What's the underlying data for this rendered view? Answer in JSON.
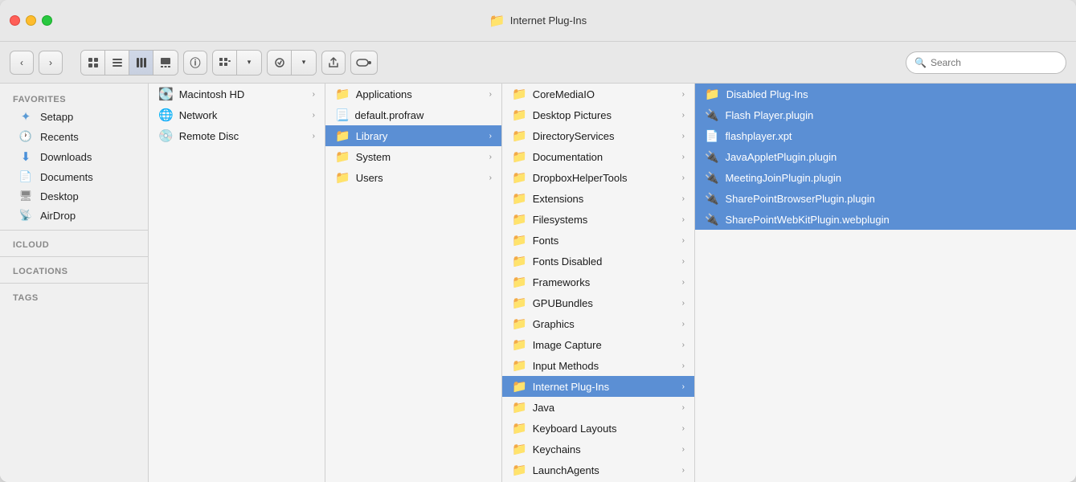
{
  "window": {
    "title": "Internet Plug-Ins"
  },
  "titlebar": {
    "title": "Internet Plug-Ins"
  },
  "toolbar": {
    "view_icon_grid": "⊞",
    "view_icon_list": "≡",
    "view_icon_column": "|||",
    "view_icon_cover": "▭",
    "info_label": "ⓘ",
    "group_label": "⊡",
    "action_label": "⚙",
    "share_label": "↑",
    "tag_label": "◯",
    "search_placeholder": "Search"
  },
  "sidebar": {
    "favorites_label": "Favorites",
    "icloud_label": "iCloud",
    "locations_label": "Locations",
    "tags_label": "Tags",
    "items": [
      {
        "id": "setapp",
        "label": "Setapp",
        "icon": "✦"
      },
      {
        "id": "recents",
        "label": "Recents",
        "icon": "🕐"
      },
      {
        "id": "downloads",
        "label": "Downloads",
        "icon": "⬇"
      },
      {
        "id": "documents",
        "label": "Documents",
        "icon": "📄"
      },
      {
        "id": "desktop",
        "label": "Desktop",
        "icon": "🖥"
      },
      {
        "id": "airdrop",
        "label": "AirDrop",
        "icon": "📡"
      }
    ]
  },
  "col1": {
    "items": [
      {
        "id": "macintosh-hd",
        "label": "Macintosh HD",
        "hasArrow": true,
        "iconType": "disk"
      },
      {
        "id": "network",
        "label": "Network",
        "hasArrow": true,
        "iconType": "network"
      },
      {
        "id": "remote-disc",
        "label": "Remote Disc",
        "hasArrow": true,
        "iconType": "disk"
      }
    ]
  },
  "col2": {
    "items": [
      {
        "id": "applications",
        "label": "Applications",
        "hasArrow": true,
        "selected": false
      },
      {
        "id": "default-profraw",
        "label": "default.profraw",
        "hasArrow": false,
        "selected": false
      },
      {
        "id": "library",
        "label": "Library",
        "hasArrow": true,
        "selected": true
      },
      {
        "id": "system",
        "label": "System",
        "hasArrow": true,
        "selected": false
      },
      {
        "id": "users",
        "label": "Users",
        "hasArrow": true,
        "selected": false
      }
    ]
  },
  "col3": {
    "items": [
      {
        "id": "coremediaio",
        "label": "CoreMediaIO",
        "hasArrow": true
      },
      {
        "id": "desktop-pictures",
        "label": "Desktop Pictures",
        "hasArrow": true
      },
      {
        "id": "directoryservices",
        "label": "DirectoryServices",
        "hasArrow": true
      },
      {
        "id": "documentation",
        "label": "Documentation",
        "hasArrow": true
      },
      {
        "id": "dropboxhelpertools",
        "label": "DropboxHelperTools",
        "hasArrow": true
      },
      {
        "id": "extensions",
        "label": "Extensions",
        "hasArrow": true
      },
      {
        "id": "filesystems",
        "label": "Filesystems",
        "hasArrow": true
      },
      {
        "id": "fonts",
        "label": "Fonts",
        "hasArrow": true
      },
      {
        "id": "fonts-disabled",
        "label": "Fonts Disabled",
        "hasArrow": true
      },
      {
        "id": "frameworks",
        "label": "Frameworks",
        "hasArrow": true
      },
      {
        "id": "gpubundles",
        "label": "GPUBundles",
        "hasArrow": true
      },
      {
        "id": "graphics",
        "label": "Graphics",
        "hasArrow": true
      },
      {
        "id": "image-capture",
        "label": "Image Capture",
        "hasArrow": true
      },
      {
        "id": "input-methods",
        "label": "Input Methods",
        "hasArrow": true
      },
      {
        "id": "internet-plug-ins",
        "label": "Internet Plug-Ins",
        "hasArrow": true,
        "selected": true
      },
      {
        "id": "java",
        "label": "Java",
        "hasArrow": true
      },
      {
        "id": "keyboard-layouts",
        "label": "Keyboard Layouts",
        "hasArrow": true
      },
      {
        "id": "keychains",
        "label": "Keychains",
        "hasArrow": true
      },
      {
        "id": "launchagents",
        "label": "LaunchAgents",
        "hasArrow": true
      }
    ]
  },
  "col4": {
    "items": [
      {
        "id": "disabled-plug-ins",
        "label": "Disabled Plug-Ins",
        "iconType": "folder-selected"
      },
      {
        "id": "flash-player-plugin",
        "label": "Flash Player.plugin",
        "iconType": "plugin-selected"
      },
      {
        "id": "flashplayer-xpt",
        "label": "flashplayer.xpt",
        "iconType": "xpt-selected"
      },
      {
        "id": "javaappletplugin",
        "label": "JavaAppletPlugin.plugin",
        "iconType": "plugin-selected"
      },
      {
        "id": "meetingjoinplugin",
        "label": "MeetingJoinPlugin.plugin",
        "iconType": "plugin-selected"
      },
      {
        "id": "sharepointbrowserplugin",
        "label": "SharePointBrowserPlugin.plugin",
        "iconType": "plugin-selected"
      },
      {
        "id": "sharepointwebkitplugin",
        "label": "SharePointWebKitPlugin.webplugin",
        "iconType": "plugin-selected"
      }
    ]
  }
}
